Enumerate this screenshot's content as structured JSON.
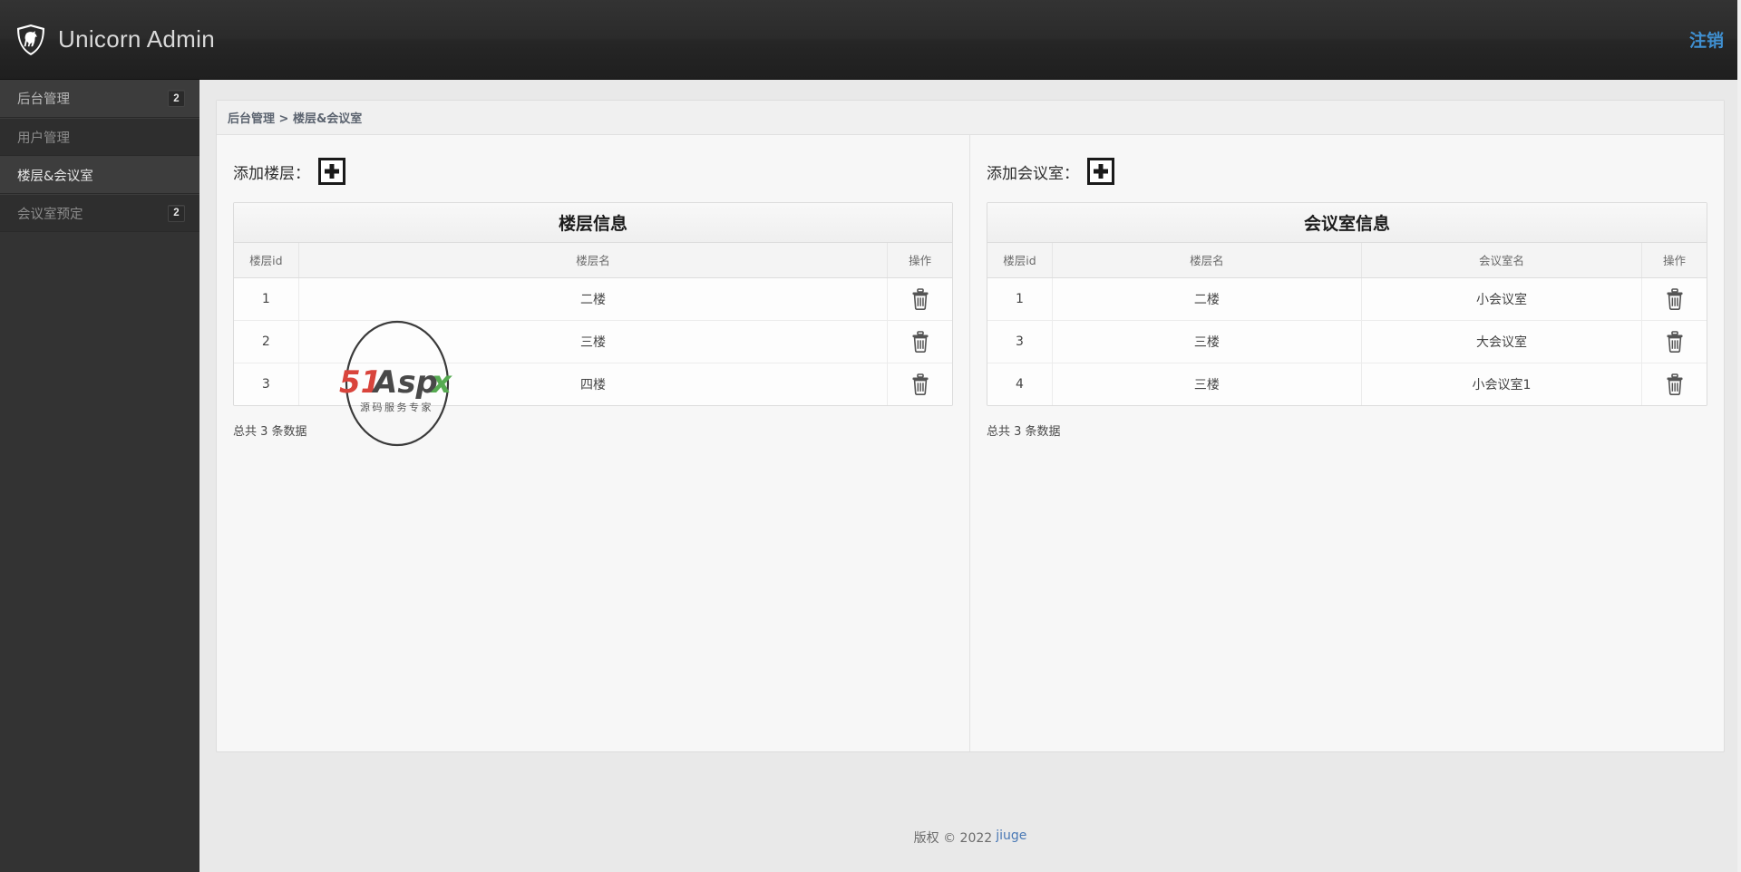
{
  "navbar": {
    "brand": "Unicorn Admin",
    "brand_icon": "shield-unicorn-icon",
    "logout_label": "注销"
  },
  "sidebar": {
    "items": [
      {
        "label": "后台管理",
        "badge": "2",
        "state": "active-parent",
        "has_caret": true
      },
      {
        "label": "用户管理",
        "badge": "",
        "state": "sub",
        "has_caret": false
      },
      {
        "label": "楼层&会议室",
        "badge": "",
        "state": "sub-current",
        "has_caret": false
      },
      {
        "label": "会议室预定",
        "badge": "2",
        "state": "sub",
        "has_caret": false
      }
    ]
  },
  "breadcrumb": "后台管理 > 楼层&会议室",
  "left_section": {
    "add_label": "添加楼层：",
    "add_icon": "plus-icon",
    "table_title": "楼层信息",
    "columns": [
      "楼层id",
      "楼层名",
      "操作"
    ],
    "rows": [
      {
        "id": "1",
        "name": "二楼",
        "action_icon": "trash-icon"
      },
      {
        "id": "2",
        "name": "三楼",
        "action_icon": "trash-icon"
      },
      {
        "id": "3",
        "name": "四楼",
        "action_icon": "trash-icon"
      }
    ],
    "total_text": "总共 3 条数据"
  },
  "right_section": {
    "add_label": "添加会议室：",
    "add_icon": "plus-icon",
    "table_title": "会议室信息",
    "columns": [
      "楼层id",
      "楼层名",
      "会议室名",
      "操作"
    ],
    "rows": [
      {
        "id": "1",
        "floor": "二楼",
        "room": "小会议室",
        "action_icon": "trash-icon"
      },
      {
        "id": "3",
        "floor": "三楼",
        "room": "大会议室",
        "action_icon": "trash-icon"
      },
      {
        "id": "4",
        "floor": "三楼",
        "room": "小会议室1",
        "action_icon": "trash-icon"
      }
    ],
    "total_text": "总共 3 条数据"
  },
  "watermark": {
    "main_text_1": "51",
    "main_text_2": "Aspx",
    "sub_text": "源码服务专家"
  },
  "footer": {
    "copyright": "版权 © 2022",
    "link": "jiuge"
  },
  "colors": {
    "navbar_bg": "#2b2b2b",
    "sidebar_bg": "#333333",
    "accent_link": "#3f8fd0",
    "page_bg": "#e9e9e9",
    "panel_bg": "#f7f7f7"
  }
}
